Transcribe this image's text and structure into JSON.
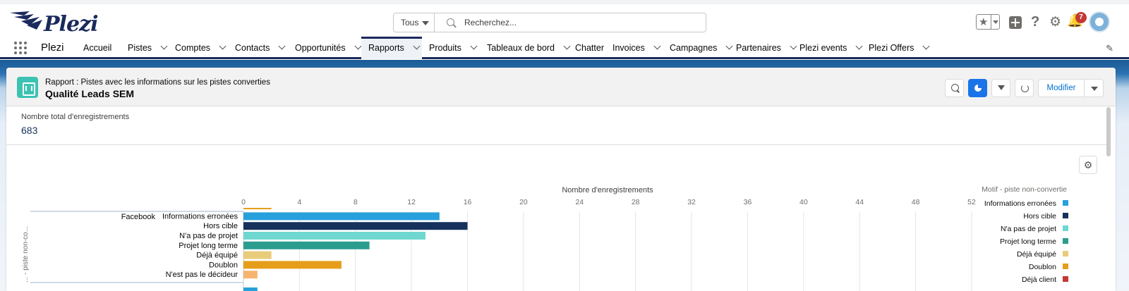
{
  "header": {
    "logo_text": "Plezi",
    "scope_label": "Tous",
    "search_placeholder": "Recherchez...",
    "notification_count": "7",
    "help_icon": "?",
    "gear_icon": "⚙",
    "bell_icon": "🔔"
  },
  "nav": {
    "app_name": "Plezi",
    "items": [
      {
        "label": "Accueil",
        "dropdown": false,
        "active": false
      },
      {
        "label": "Pistes",
        "dropdown": true,
        "active": false
      },
      {
        "label": "Comptes",
        "dropdown": true,
        "active": false
      },
      {
        "label": "Contacts",
        "dropdown": true,
        "active": false
      },
      {
        "label": "Opportunités",
        "dropdown": true,
        "active": false
      },
      {
        "label": "Rapports",
        "dropdown": true,
        "active": true
      },
      {
        "label": "Produits",
        "dropdown": true,
        "active": false
      },
      {
        "label": "Tableaux de bord",
        "dropdown": true,
        "active": false
      },
      {
        "label": "Chatter",
        "dropdown": false,
        "active": false
      },
      {
        "label": "Invoices",
        "dropdown": true,
        "active": false
      },
      {
        "label": "Campagnes",
        "dropdown": true,
        "active": false
      },
      {
        "label": "Partenaires",
        "dropdown": true,
        "active": false
      },
      {
        "label": "Plezi events",
        "dropdown": true,
        "active": false
      },
      {
        "label": "Plezi Offers",
        "dropdown": true,
        "active": false
      }
    ]
  },
  "report": {
    "subtitle": "Rapport : Pistes avec les informations sur les pistes converties",
    "title": "Qualité Leads SEM",
    "modify_label": "Modifier",
    "total_label": "Nombre total d'enregistrements",
    "total_value": "683"
  },
  "chart_data": {
    "type": "bar",
    "orientation": "horizontal",
    "xlabel": "Nombre d'enregistrements",
    "ylabel": "... - piste non-co...",
    "xlim": [
      0,
      52
    ],
    "xticks": [
      0,
      4,
      8,
      12,
      16,
      20,
      24,
      28,
      32,
      36,
      40,
      44,
      48,
      52
    ],
    "group_label": "Facebook",
    "categories": [
      "Informations erronées",
      "Hors cible",
      "N'a pas de projet",
      "Projet long terme",
      "Déjà équipé",
      "Doublon",
      "N'est pas le décideur"
    ],
    "values": [
      14,
      16,
      13,
      9,
      2,
      7,
      1
    ],
    "colors": [
      "#27a0dc",
      "#16325c",
      "#6fd7d0",
      "#2a9d8f",
      "#e8cc7b",
      "#e69e1a",
      "#f5b56e"
    ],
    "legend_title": "Motif - piste non-convertie",
    "legend": [
      {
        "label": "Informations erronées",
        "color": "#27a0dc"
      },
      {
        "label": "Hors cible",
        "color": "#16325c"
      },
      {
        "label": "N'a pas de projet",
        "color": "#6fd7d0"
      },
      {
        "label": "Projet long terme",
        "color": "#2a9d8f"
      },
      {
        "label": "Déjà équipé",
        "color": "#e8cc7b"
      },
      {
        "label": "Doublon",
        "color": "#e69e1a"
      },
      {
        "label": "Déjà client",
        "color": "#c23934"
      }
    ],
    "partial_previous_bar": {
      "value": 2,
      "color": "#e69e1a"
    },
    "grid": true,
    "legend_position": "right"
  }
}
